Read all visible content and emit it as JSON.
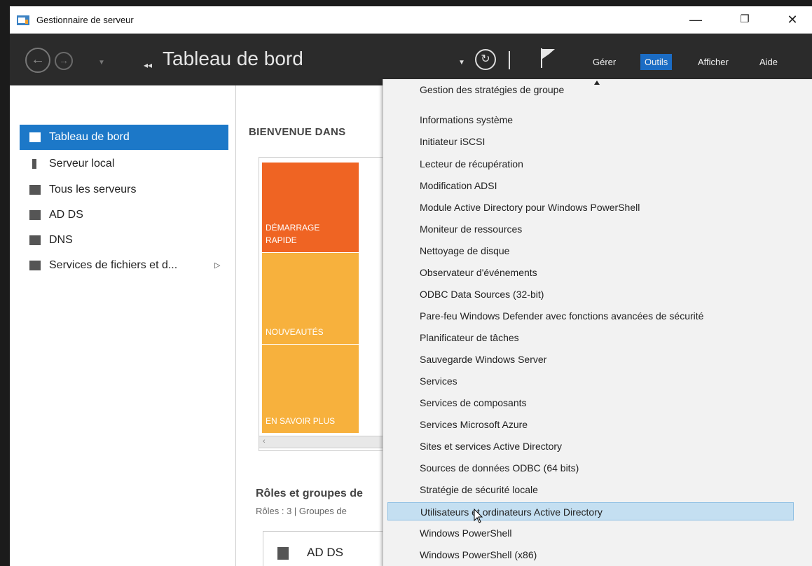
{
  "window": {
    "title": "Gestionnaire de serveur",
    "controls": {
      "minimize": "—",
      "restore": "❐",
      "close": "✕"
    }
  },
  "toolbar": {
    "breadcrumb_arrows": "◂◂",
    "breadcrumb": "Tableau de bord",
    "menu": [
      {
        "label": "Gérer",
        "active": false
      },
      {
        "label": "Outils",
        "active": true
      },
      {
        "label": "Afficher",
        "active": false
      },
      {
        "label": "Aide",
        "active": false
      }
    ]
  },
  "sidebar": {
    "items": [
      {
        "label": "Tableau de bord",
        "icon": "dashboard-icon",
        "selected": true
      },
      {
        "label": "Serveur local",
        "icon": "server-icon",
        "selected": false
      },
      {
        "label": "Tous les serveurs",
        "icon": "servers-icon",
        "selected": false
      },
      {
        "label": "AD DS",
        "icon": "adds-icon",
        "selected": false
      },
      {
        "label": "DNS",
        "icon": "dns-icon",
        "selected": false
      },
      {
        "label": "Services de fichiers et d...",
        "icon": "file-services-icon",
        "selected": false,
        "has_submenu": true
      }
    ]
  },
  "main": {
    "welcome": "BIENVENUE DANS",
    "tiles": [
      {
        "label": "DÉMARRAGE RAPIDE",
        "color": "#ef6423"
      },
      {
        "label": "NOUVEAUTÉS",
        "color": "#f7b13d"
      },
      {
        "label": "EN SAVOIR PLUS",
        "color": "#f7b13d"
      }
    ],
    "roles_title": "Rôles et groupes de",
    "roles_sub": "Rôles : 3  |  Groupes de",
    "card_label": "AD DS"
  },
  "outils_menu": {
    "items": [
      "Gestion des stratégies de groupe",
      "Informations système",
      "Initiateur iSCSI",
      "Lecteur de récupération",
      "Modification ADSI",
      "Module Active Directory pour Windows PowerShell",
      "Moniteur de ressources",
      "Nettoyage de disque",
      "Observateur d'événements",
      "ODBC Data Sources (32-bit)",
      "Pare-feu Windows Defender avec fonctions avancées de sécurité",
      "Planificateur de tâches",
      "Sauvegarde Windows Server",
      "Services",
      "Services de composants",
      "Services Microsoft Azure",
      "Sites et services Active Directory",
      "Sources de données ODBC (64 bits)",
      "Stratégie de sécurité locale",
      "Utilisateurs et ordinateurs Active Directory",
      "Windows PowerShell",
      "Windows PowerShell (x86)"
    ],
    "hovered": "Utilisateurs et ordinateurs Active Directory"
  }
}
